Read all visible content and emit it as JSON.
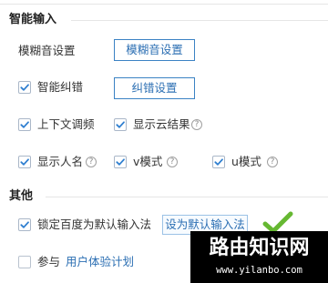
{
  "smart_input": {
    "title": "智能输入",
    "fuzzy_pinyin": {
      "label": "模糊音设置",
      "button": "模糊音设置"
    },
    "smart_correction": {
      "label": "智能纠错",
      "checked": true,
      "button": "纠错设置"
    },
    "context_tuning": {
      "label": "上下文调频",
      "checked": true
    },
    "show_cloud_results": {
      "label": "显示云结果",
      "checked": true,
      "help": "?"
    },
    "show_person_names": {
      "label": "显示人名",
      "checked": true,
      "help": "?"
    },
    "v_mode": {
      "label": "v模式",
      "checked": true,
      "help": "?"
    },
    "u_mode": {
      "label": "u模式",
      "checked": true,
      "help": "?"
    }
  },
  "other": {
    "title": "其他",
    "lock_default": {
      "label": "锁定百度为默认输入法",
      "checked": true,
      "button": "设为默认输入法"
    },
    "participate": {
      "label": "参与",
      "checked": false,
      "link": "用户体验计划"
    }
  },
  "watermark": {
    "title": "路由知识网",
    "url": "www.yilanbo.com"
  },
  "colors": {
    "accent": "#2c6fb3",
    "check": "#2f7fd0",
    "status_check": "#66b832",
    "divider": "#e6e6e6"
  }
}
